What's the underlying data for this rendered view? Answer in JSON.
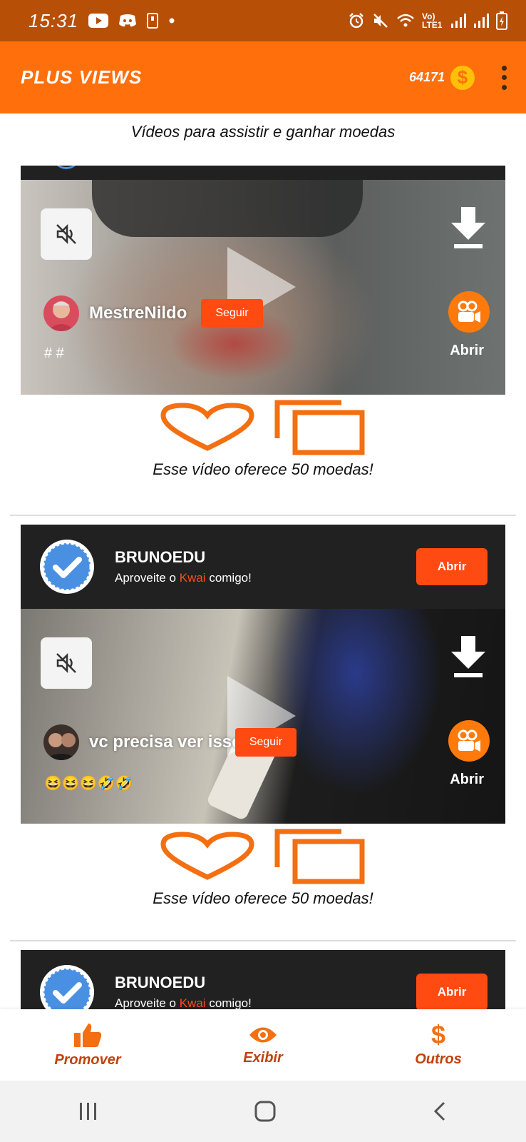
{
  "status_bar": {
    "time": "15:31",
    "network_label": "Vo) LTE1"
  },
  "app_bar": {
    "title": "PLUS VIEWS",
    "coins": "64171",
    "coin_symbol": "$"
  },
  "subtitle": "Vídeos para assistir e ganhar moedas",
  "cards": [
    {
      "video": {
        "author": "MestreNildo",
        "follow_label": "Seguir",
        "caption": "# #",
        "open_label": "Abrir"
      },
      "offer": "Esse vídeo oferece 50 moedas!"
    },
    {
      "header": {
        "name": "BRUNOEDU",
        "desc_prefix": "Aproveite o ",
        "desc_highlight": "Kwai",
        "desc_suffix": " comigo!",
        "open_label": "Abrir"
      },
      "video": {
        "author": "vc precisa ver isso",
        "follow_label": "Seguir",
        "caption": "😆😆😆🤣🤣",
        "open_label": "Abrir"
      },
      "offer": "Esse vídeo oferece 50 moedas!"
    },
    {
      "header": {
        "name": "BRUNOEDU",
        "desc_prefix": "Aproveite o ",
        "desc_highlight": "Kwai",
        "desc_suffix": " comigo!",
        "open_label": "Abrir"
      }
    }
  ],
  "bottom_nav": [
    {
      "label": "Promover",
      "icon": "thumbs-up-icon"
    },
    {
      "label": "Exibir",
      "icon": "eye-icon"
    },
    {
      "label": "Outros",
      "icon": "dollar-icon"
    }
  ],
  "colors": {
    "status_bar": "#b84f07",
    "app_bar": "#ff6f0c",
    "accent": "#ff4a12",
    "nav_label": "#c2410c"
  }
}
